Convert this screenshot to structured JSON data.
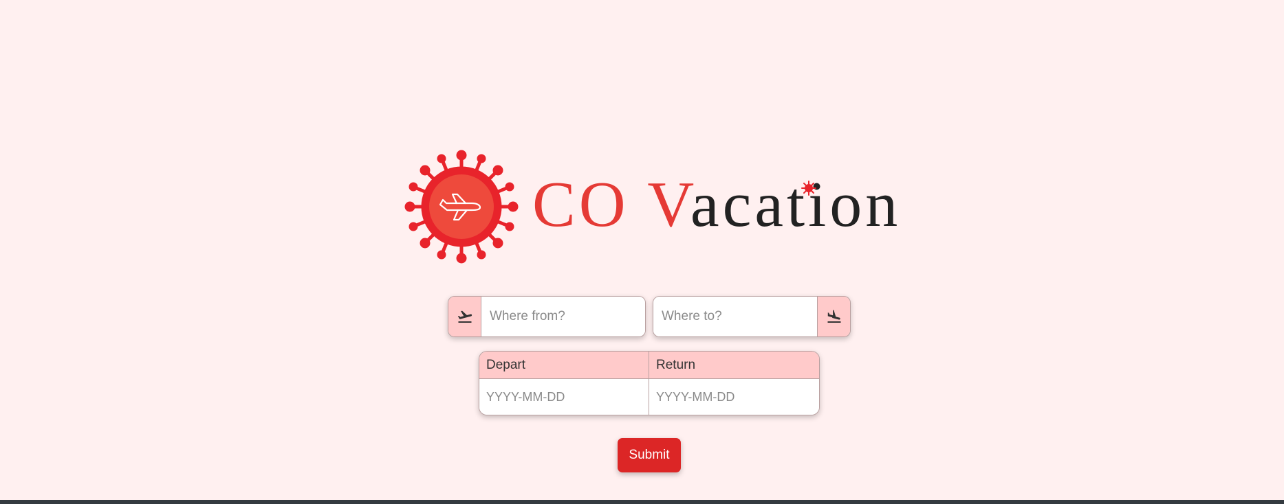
{
  "logo": {
    "part1": "CO V",
    "part2": "acation",
    "colors": {
      "red": "#e53a35",
      "dark": "#222222"
    },
    "emblem_icon": "virus-airplane-icon"
  },
  "search": {
    "from_placeholder": "Where from?",
    "from_value": "",
    "from_icon": "plane-departure-icon",
    "to_placeholder": "Where to?",
    "to_value": "",
    "to_icon": "plane-arrival-icon"
  },
  "dates": {
    "depart_label": "Depart",
    "return_label": "Return",
    "depart_placeholder": "YYYY-MM-DD",
    "return_placeholder": "YYYY-MM-DD",
    "depart_value": "",
    "return_value": ""
  },
  "submit": {
    "label": "Submit"
  },
  "colors": {
    "background": "#fff0f0",
    "accent_pink": "#ffcaca",
    "button_red": "#dc2626",
    "footer": "#343a40"
  }
}
